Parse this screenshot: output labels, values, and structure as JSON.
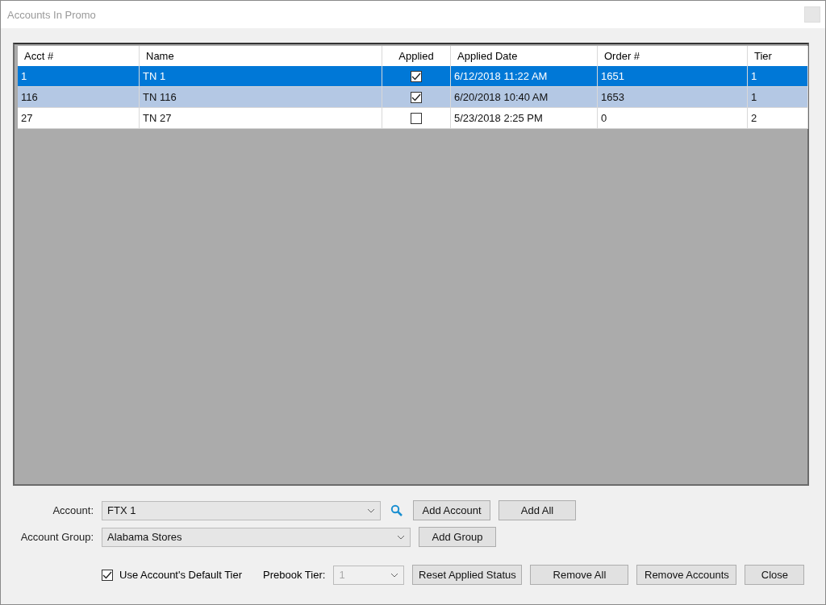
{
  "window": {
    "title": "Accounts In Promo"
  },
  "table": {
    "columns": [
      "Acct #",
      "Name",
      "Applied",
      "Applied Date",
      "Order #",
      "Tier"
    ],
    "rows": [
      {
        "acct": "1",
        "name": "TN 1",
        "applied": true,
        "date": "6/12/2018 11:22 AM",
        "order": "1651",
        "tier": "1",
        "selected": true,
        "focused": true
      },
      {
        "acct": "116",
        "name": "TN 116",
        "applied": true,
        "date": "6/20/2018 10:40 AM",
        "order": "1653",
        "tier": "1",
        "selected": true,
        "focused": false
      },
      {
        "acct": "27",
        "name": "TN 27",
        "applied": false,
        "date": "5/23/2018 2:25 PM",
        "order": "0",
        "tier": "2",
        "selected": false,
        "focused": false
      }
    ]
  },
  "account": {
    "label": "Account:",
    "value": "FTX 1"
  },
  "account_buttons": [
    "Add Account",
    "Add All"
  ],
  "account_group": {
    "label": "Account Group:",
    "value": "Alabama Stores"
  },
  "group_button": "Add Group",
  "use_default_tier": {
    "label": "Use Account's Default Tier",
    "checked": true
  },
  "prebook_tier": {
    "label": "Prebook Tier:",
    "value": "1",
    "disabled": true
  },
  "buttons": [
    "Reset Applied Status",
    "Remove All",
    "Remove Accounts",
    "Close"
  ]
}
